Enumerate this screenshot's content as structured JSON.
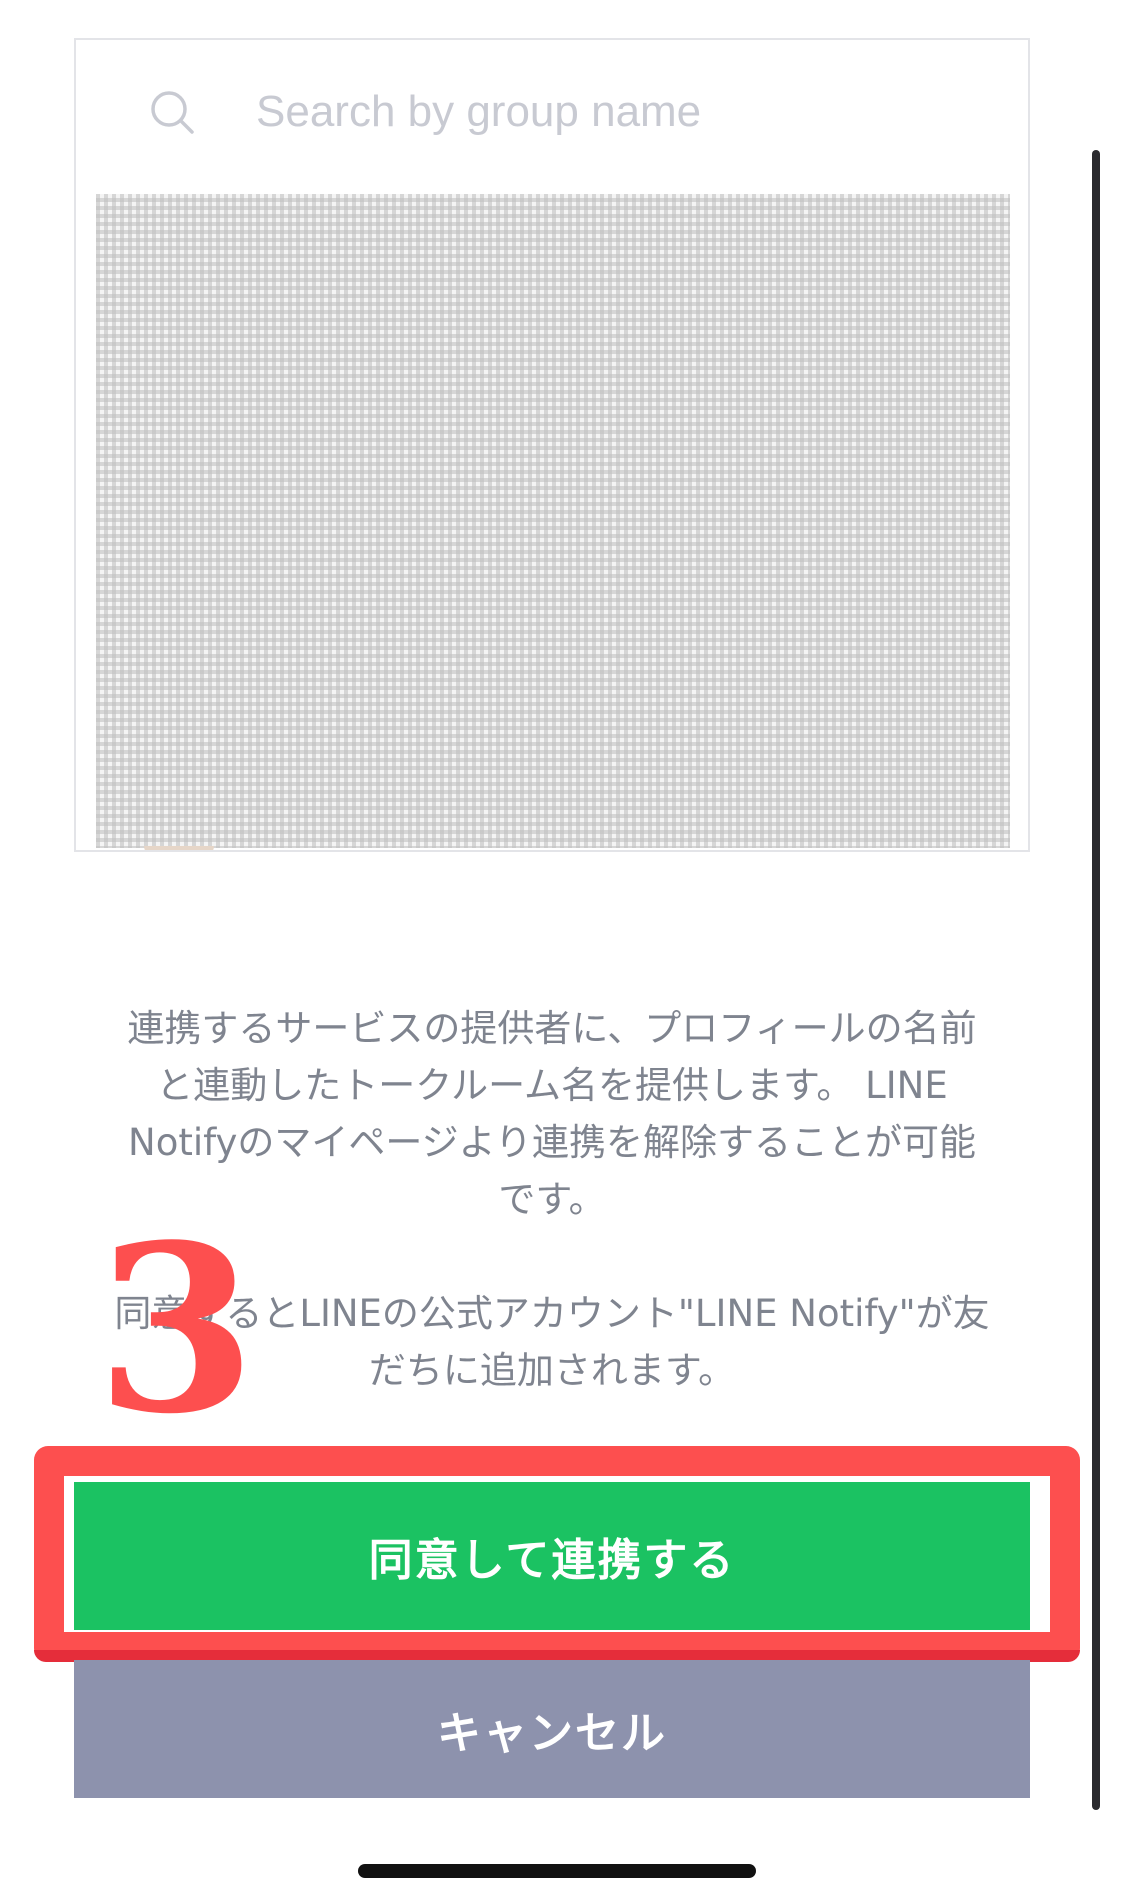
{
  "search": {
    "placeholder": "Search by group name",
    "icon": "search-icon"
  },
  "notice": {
    "paragraph1_lines": [
      "連携するサービスの提供者に、プロフィールの名前",
      "と連動したトークルーム名を提供します。 LINE",
      "Notifyのマイページより連携を解除することが可能",
      "です。"
    ],
    "paragraph2_lines": [
      "同意するとLINEの公式アカウント\"LINE Notify\"が友",
      "だちに追加されます。"
    ]
  },
  "annotation": {
    "step_number": "3",
    "color": "#fd4f4f"
  },
  "buttons": {
    "agree_label": "同意して連携する",
    "cancel_label": "キャンセル"
  },
  "colors": {
    "agree_bg": "#1bc262",
    "cancel_bg": "#8d92ad",
    "text_muted": "#7f848f",
    "placeholder": "#c8cad2"
  }
}
